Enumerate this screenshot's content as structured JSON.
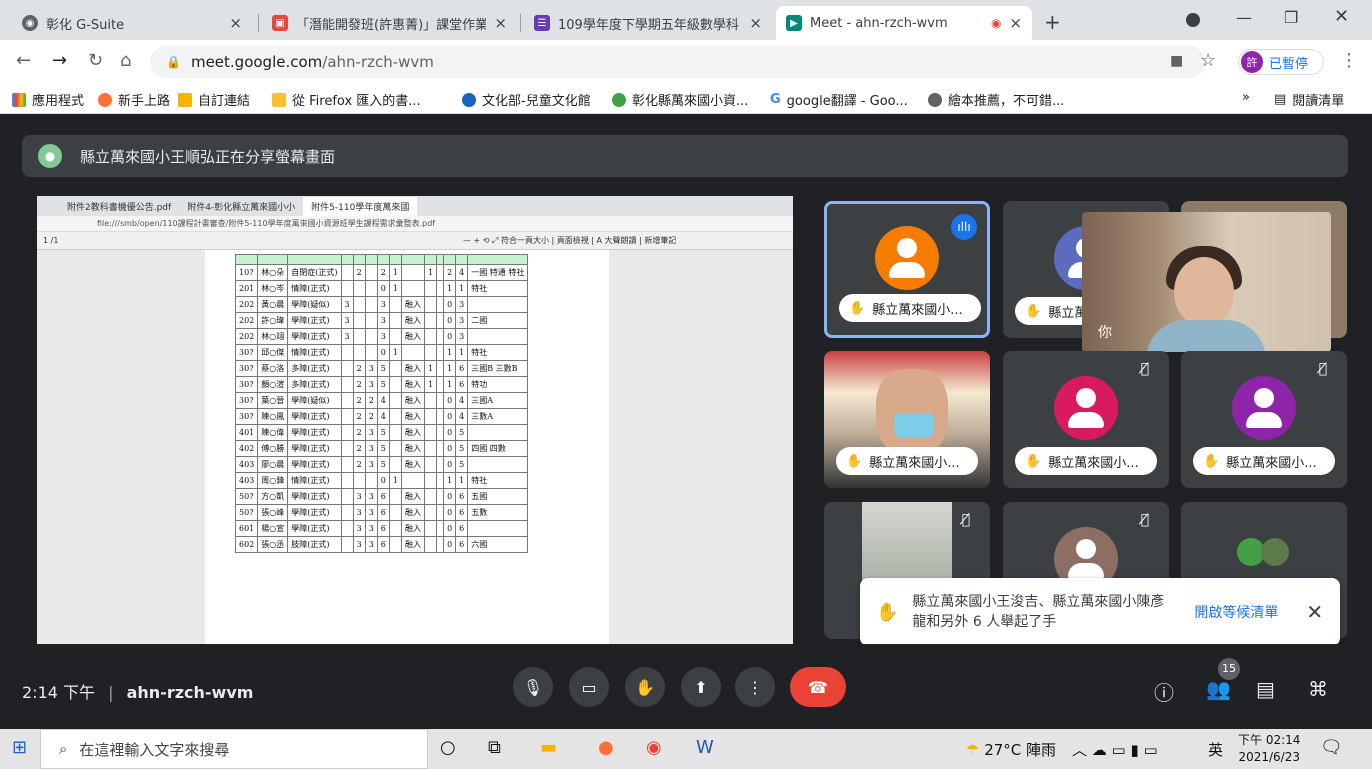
{
  "browser": {
    "tabs": [
      {
        "title": "彰化 G-Suite",
        "icon": "globe-icon",
        "color": "#5f6368"
      },
      {
        "title": "「潛能開發班(許惠菁)」課堂作業",
        "icon": "classroom-icon",
        "color": "#e8453c"
      },
      {
        "title": "109學年度下學期五年級數學科",
        "icon": "forms-icon",
        "color": "#673ab7"
      },
      {
        "title": "Meet - ahn-rzch-wvm",
        "icon": "meet-icon",
        "color": "#00897b"
      }
    ],
    "new_tab": "+",
    "url_host": "meet.google.com",
    "url_path": "/ahn-rzch-wvm",
    "profile_initial": "許",
    "profile_status": "已暫停",
    "bookmarks": [
      {
        "label": "應用程式",
        "color": "#4285f4"
      },
      {
        "label": "新手上路",
        "color": "#ff7139"
      },
      {
        "label": "自訂連結",
        "color": "#f4b400"
      },
      {
        "label": "從 Firefox 匯入的書...",
        "color": "#fbc02d"
      },
      {
        "label": "文化部-兒童文化館",
        "color": "#1565c0"
      },
      {
        "label": "彰化縣萬來國小資...",
        "color": "#43a047"
      },
      {
        "label": "google翻譯 - Goo...",
        "color": "#4285f4"
      },
      {
        "label": "繪本推薦，不可錯...",
        "color": "#5f6368"
      }
    ],
    "more_bookmarks": "»",
    "reading_list": "閱讀清單"
  },
  "meet": {
    "share_banner": "縣立萬來國小王順弘正在分享螢幕畫面",
    "shared_screen": {
      "tabs": [
        "附件2教科書機優公告.pdf",
        "附件4-彰化縣立萬來國小小",
        "附件5-110學年度萬來國"
      ],
      "address": "file:///smb/open/110課程計畫審查/附件5-110學年度萬來國小資源班學生課程需求彙整表.pdf",
      "page_indicator": "1  /1",
      "toolbar": "—  +  ⟲  ⤢  符合一頁大小  |  頁面檢視  |  A 大聲朗讀  |  新增筆記",
      "rows": [
        [
          "10?",
          "林○朵",
          "自閉症(正式)",
          "",
          "2",
          "",
          "2",
          "1",
          "",
          "1",
          "",
          "2",
          "4",
          "一國 特通 特社"
        ],
        [
          "201",
          "林○岑",
          "情障(正式)",
          "",
          "",
          "",
          "0",
          "1",
          "",
          "",
          "",
          "1",
          "1",
          "特社"
        ],
        [
          "202",
          "黃○晨",
          "學障(疑似)",
          "3",
          "",
          "",
          "3",
          "",
          "融入",
          "",
          "",
          "0",
          "3",
          ""
        ],
        [
          "202",
          "許○瑋",
          "學障(正式)",
          "3",
          "",
          "",
          "3",
          "",
          "融入",
          "",
          "",
          "0",
          "3",
          "二國"
        ],
        [
          "202",
          "林○翊",
          "學障(正式)",
          "3",
          "",
          "",
          "3",
          "",
          "融入",
          "",
          "",
          "0",
          "3",
          ""
        ],
        [
          "30?",
          "邱○傑",
          "情障(正式)",
          "",
          "",
          "",
          "0",
          "1",
          "",
          "",
          "",
          "1",
          "1",
          "特社"
        ],
        [
          "30?",
          "蔡○洛",
          "多障(正式)",
          "",
          "2",
          "3",
          "5",
          "",
          "融入",
          "1",
          "",
          "1",
          "6",
          "三國B 三數B"
        ],
        [
          "30?",
          "顏○渲",
          "多障(正式)",
          "",
          "2",
          "3",
          "5",
          "",
          "融入",
          "1",
          "",
          "1",
          "6",
          "特功"
        ],
        [
          "30?",
          "葉○晉",
          "學障(疑似)",
          "",
          "2",
          "2",
          "4",
          "",
          "融入",
          "",
          "",
          "0",
          "4",
          "三國A"
        ],
        [
          "30?",
          "陳○鳳",
          "學障(正式)",
          "",
          "2",
          "2",
          "4",
          "",
          "融入",
          "",
          "",
          "0",
          "4",
          "三數A"
        ],
        [
          "401",
          "陳○偉",
          "學障(正式)",
          "",
          "2",
          "3",
          "5",
          "",
          "融入",
          "",
          "",
          "0",
          "5",
          ""
        ],
        [
          "402",
          "傅○勝",
          "學障(正式)",
          "",
          "2",
          "3",
          "5",
          "",
          "融入",
          "",
          "",
          "0",
          "5",
          "四國 四數"
        ],
        [
          "403",
          "廖○晨",
          "學障(正式)",
          "",
          "2",
          "3",
          "5",
          "",
          "融入",
          "",
          "",
          "0",
          "5",
          ""
        ],
        [
          "403",
          "周○鋒",
          "情障(正式)",
          "",
          "",
          "",
          "0",
          "1",
          "",
          "",
          "",
          "1",
          "1",
          "特社"
        ],
        [
          "50?",
          "方○凱",
          "學障(正式)",
          "",
          "3",
          "3",
          "6",
          "",
          "融入",
          "",
          "",
          "0",
          "6",
          "五國"
        ],
        [
          "50?",
          "張○峰",
          "學障(正式)",
          "",
          "3",
          "3",
          "6",
          "",
          "融入",
          "",
          "",
          "0",
          "6",
          "五數"
        ],
        [
          "601",
          "楊○宣",
          "學障(正式)",
          "",
          "3",
          "3",
          "6",
          "",
          "融入",
          "",
          "",
          "0",
          "6",
          ""
        ],
        [
          "602",
          "張○丞",
          "肢障(正式)",
          "",
          "3",
          "3",
          "6",
          "",
          "融入",
          "",
          "",
          "0",
          "6",
          "六國"
        ]
      ]
    },
    "tiles": [
      {
        "name": "縣立萬來國小...",
        "avatar_color": "#f57c00",
        "hand": true,
        "speaking": true
      },
      {
        "name": "縣立萬來...",
        "avatar_color": "#5c6bc0",
        "hand": true
      },
      {
        "name": "縣立萬來國小...",
        "photo": true,
        "hand": true
      },
      {
        "name": "縣立萬來國小...",
        "avatar_color": "#d81b60",
        "hand": true,
        "muted": true
      },
      {
        "name": "縣立萬來國小...",
        "avatar_color": "#8e24aa",
        "hand": true,
        "muted": true
      },
      {
        "name": "",
        "photo": true,
        "muted": true
      },
      {
        "name": "",
        "avatar_color": "#8d6e63",
        "muted": true
      },
      {
        "name": "",
        "avatar_color": "#43a047"
      }
    ],
    "self_label": "你",
    "toast": {
      "message": "縣立萬來國小王浚吉、縣立萬來國小陳彥龍和另外 6 人舉起了手",
      "action": "開啟等候清單"
    },
    "controls": {
      "time": "2:14 下午",
      "separator": "|",
      "meeting_code": "ahn-rzch-wvm",
      "people_count": "15"
    }
  },
  "taskbar": {
    "search_placeholder": "在這裡輸入文字來搜尋",
    "weather": "27°C 陣雨",
    "ime": "英",
    "time": "下午 02:14",
    "date": "2021/6/23"
  }
}
